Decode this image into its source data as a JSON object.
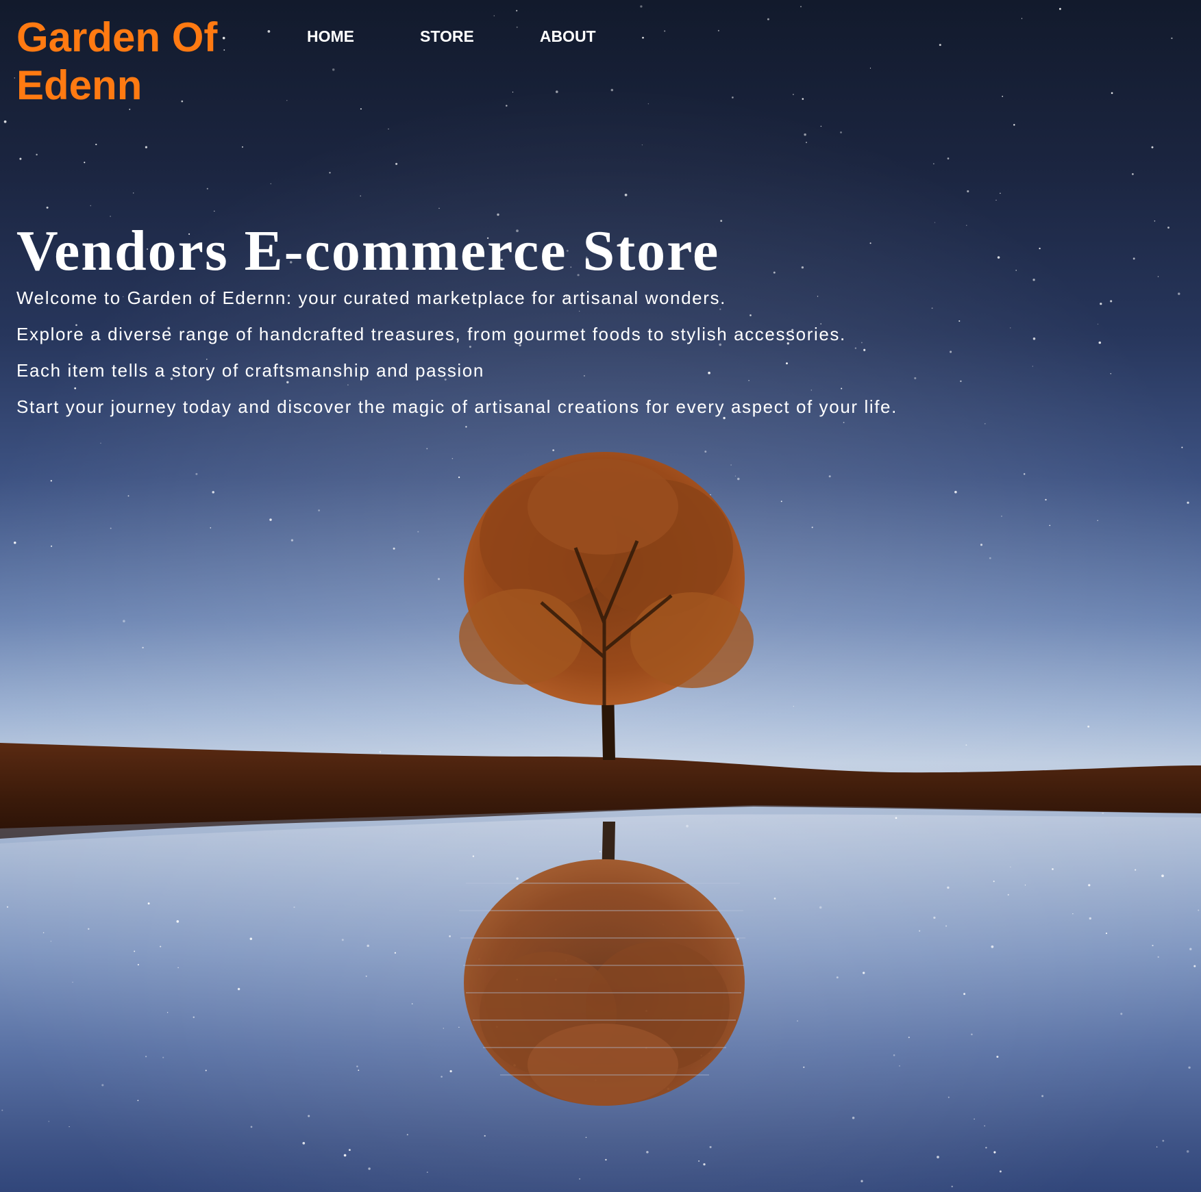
{
  "brand": {
    "name": "Garden Of Edenn",
    "color": "#ff7a12"
  },
  "nav": {
    "items": [
      {
        "label": "HOME"
      },
      {
        "label": "STORE"
      },
      {
        "label": "ABOUT"
      }
    ]
  },
  "hero": {
    "title": "Vendors E-commerce Store",
    "paragraphs": [
      "Welcome to Garden of Edernn: your curated marketplace for artisanal wonders.",
      "Explore a diverse range of handcrafted treasures, from gourmet foods to stylish accessories.",
      "Each item tells a story of craftsmanship and passion",
      "Start your journey today and discover the magic of artisanal creations for every aspect of your life."
    ],
    "background_image": "night-sky-tree-reflection"
  }
}
